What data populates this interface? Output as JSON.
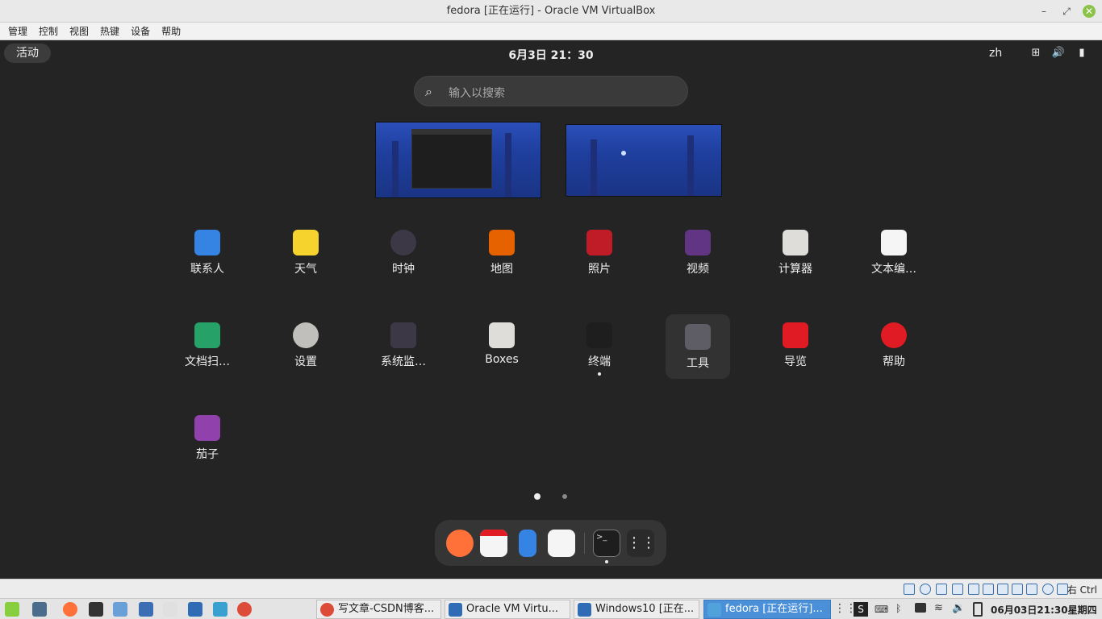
{
  "window": {
    "title": "fedora [正在运行] - Oracle VM VirtualBox"
  },
  "menu": [
    "管理",
    "控制",
    "视图",
    "热键",
    "设备",
    "帮助"
  ],
  "gnome": {
    "activities": "活动",
    "clock": "6月3日  21：30",
    "lang": "zh",
    "search_placeholder": "输入以搜索",
    "apps": [
      {
        "label": "联系人",
        "icon": "contacts-icon",
        "color": "#3584e4"
      },
      {
        "label": "天气",
        "icon": "weather-icon",
        "color": "#f6d32d"
      },
      {
        "label": "时钟",
        "icon": "clock-icon",
        "color": "#3d3846"
      },
      {
        "label": "地图",
        "icon": "maps-icon",
        "color": "#e66100"
      },
      {
        "label": "照片",
        "icon": "photos-icon",
        "color": "#c01c28"
      },
      {
        "label": "视频",
        "icon": "videos-icon",
        "color": "#613583"
      },
      {
        "label": "计算器",
        "icon": "calculator-icon",
        "color": "#deddda"
      },
      {
        "label": "文本编…",
        "icon": "text-editor-icon",
        "color": "#f5f5f5"
      },
      {
        "label": "文档扫…",
        "icon": "document-scanner-icon",
        "color": "#26a269"
      },
      {
        "label": "设置",
        "icon": "settings-icon",
        "color": "#c0bfbc"
      },
      {
        "label": "系统监…",
        "icon": "system-monitor-icon",
        "color": "#3d3846"
      },
      {
        "label": "Boxes",
        "icon": "boxes-icon",
        "color": "#deddda"
      },
      {
        "label": "终端",
        "icon": "terminal-icon",
        "color": "#1e1e1e"
      },
      {
        "label": "工具",
        "icon": "utilities-folder-icon",
        "color": "#5e5c64"
      },
      {
        "label": "导览",
        "icon": "tour-balloon-icon",
        "color": "#e01b24"
      },
      {
        "label": "帮助",
        "icon": "help-lifebuoy-icon",
        "color": "#e01b24"
      },
      {
        "label": "茄子",
        "icon": "cheese-icon",
        "color": "#9141ac"
      }
    ],
    "dock": [
      {
        "name": "firefox",
        "icon": "firefox-icon",
        "color": "#ff7139"
      },
      {
        "name": "calendar",
        "icon": "calendar-icon",
        "color": "#f5f5f5"
      },
      {
        "name": "phone",
        "icon": "phone-icon",
        "color": "#3584e4"
      },
      {
        "name": "software",
        "icon": "software-icon",
        "color": "#f5f5f5"
      },
      {
        "name": "terminal",
        "icon": "terminal-icon",
        "color": "#1e1e1e"
      },
      {
        "name": "app-grid",
        "icon": "app-grid-icon",
        "color": "#353535"
      }
    ]
  },
  "vbox_status": {
    "host_key": "右 Ctrl"
  },
  "taskbar": {
    "tasks": [
      {
        "label": "写文章-CSDN博客...",
        "icon": "chrome-icon",
        "color": "#dd4b39"
      },
      {
        "label": "Oracle VM Virtu...",
        "icon": "virtualbox-icon",
        "color": "#2f6cb5"
      },
      {
        "label": "Windows10 [正在...",
        "icon": "windows-vm-icon",
        "color": "#2f6cb5"
      },
      {
        "label": "fedora [正在运行]...",
        "icon": "fedora-icon",
        "color": "#51a2da"
      }
    ],
    "ime": "S",
    "clock": "06月03日21:30星期四"
  }
}
